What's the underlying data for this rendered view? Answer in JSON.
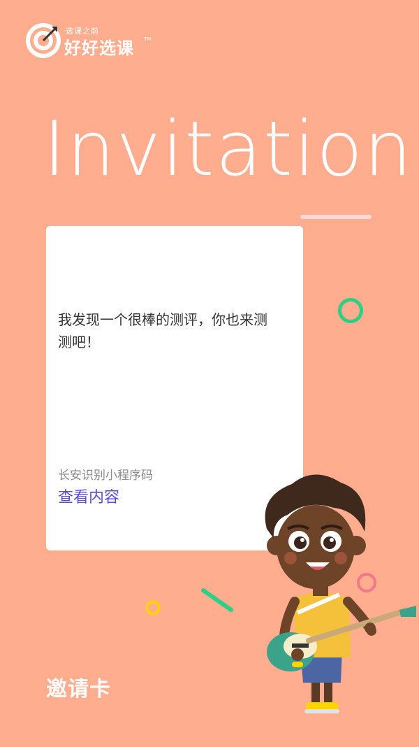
{
  "brand": {
    "subtitle": "选课之前",
    "name": "好好选课",
    "trademark": "TM",
    "logo_icon": "target-arrow-icon"
  },
  "hero": {
    "title": "Invitation"
  },
  "card": {
    "message": "我发现一个很棒的测评，你也来测测吧！",
    "hint": "长安识别小程序码",
    "link_label": "查看内容"
  },
  "footer": {
    "label": "邀请卡"
  },
  "colors": {
    "background": "#FFAD8E",
    "accent_link": "#5B4DCF",
    "ring_green": "#2DCF86",
    "ring_pink": "#F0788A",
    "ring_yellow": "#FFD400",
    "dash_green": "#2DCF86"
  },
  "illustration": {
    "name": "boy-with-guitar"
  }
}
